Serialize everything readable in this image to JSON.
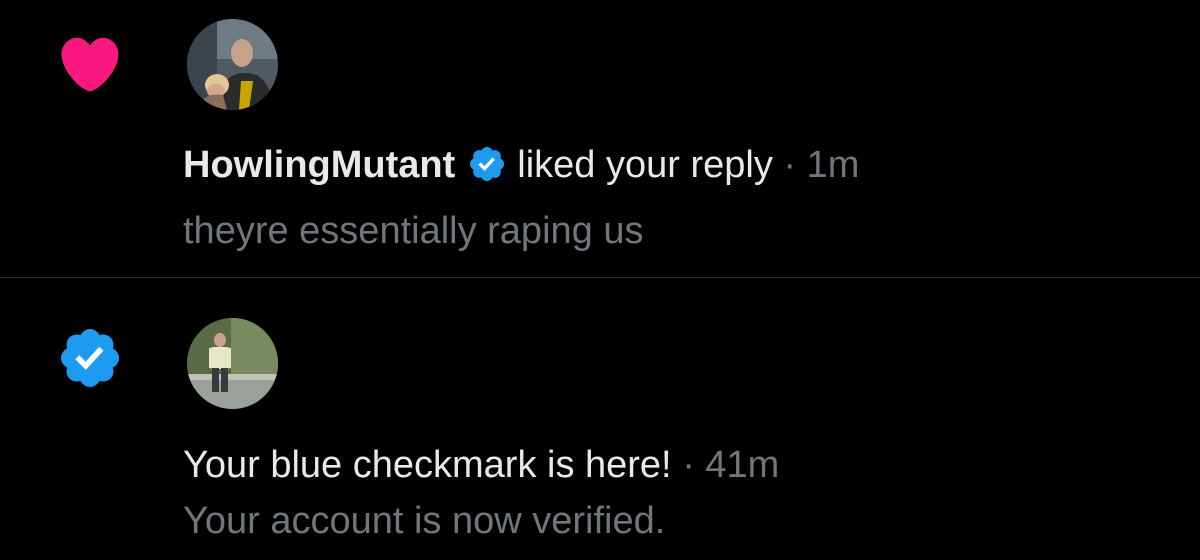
{
  "colors": {
    "background": "#000000",
    "primary_text": "#e7e9ea",
    "secondary_text": "#71767b",
    "like_pink": "#f91880",
    "verified_blue": "#1d9bf0",
    "divider": "#2f3336"
  },
  "notifications": [
    {
      "type_icon": "heart-icon",
      "avatar": "user-avatar-photo",
      "name": "HowlingMutant",
      "verified_badge": "verified-badge-icon",
      "action": "liked your reply",
      "separator": "·",
      "time": "1m",
      "content": "theyre essentially raping us"
    },
    {
      "type_icon": "verified-badge-icon",
      "avatar": "user-avatar-photo",
      "action": "Your blue checkmark is here!",
      "separator": "·",
      "time": "41m",
      "content": "Your account is now verified."
    }
  ]
}
